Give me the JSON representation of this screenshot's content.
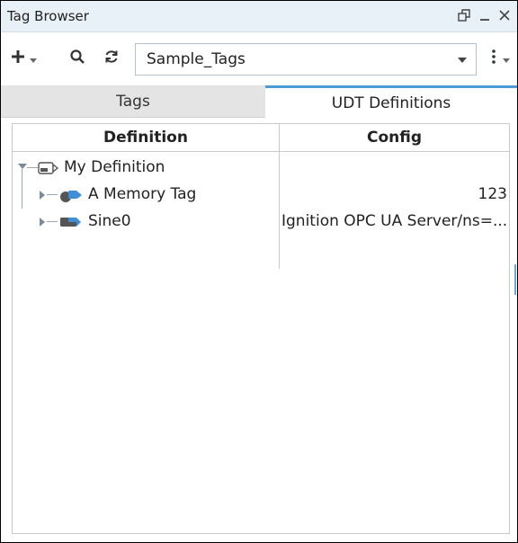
{
  "window": {
    "title": "Tag Browser",
    "restore_icon": "restore-window-icon",
    "minimize_icon": "minimize-icon",
    "close_icon": "close-icon"
  },
  "toolbar": {
    "add_icon": "add-icon",
    "search_icon": "search-icon",
    "refresh_icon": "refresh-icon",
    "more_icon": "more-vertical-icon",
    "provider": {
      "selected": "Sample_Tags"
    }
  },
  "tabs": [
    {
      "label": "Tags",
      "active": false
    },
    {
      "label": "UDT Definitions",
      "active": true
    }
  ],
  "table": {
    "columns": [
      "Definition",
      "Config"
    ],
    "rows": [
      {
        "name": "My Definition",
        "config": "",
        "icon": "udt-definition-icon",
        "expanded": true
      },
      {
        "name": "A Memory Tag",
        "config": "123",
        "icon": "memory-tag-icon",
        "expanded": false
      },
      {
        "name": "Sine0",
        "config": "Ignition OPC UA Server/ns=...",
        "icon": "opc-tag-icon",
        "expanded": false
      }
    ]
  },
  "colors": {
    "titlebar_bg": "#e9f1f8",
    "active_tab_accent": "#4a9cd6",
    "inactive_tab_bg": "#e4e4e4",
    "icon_blue": "#3f8ed6"
  }
}
